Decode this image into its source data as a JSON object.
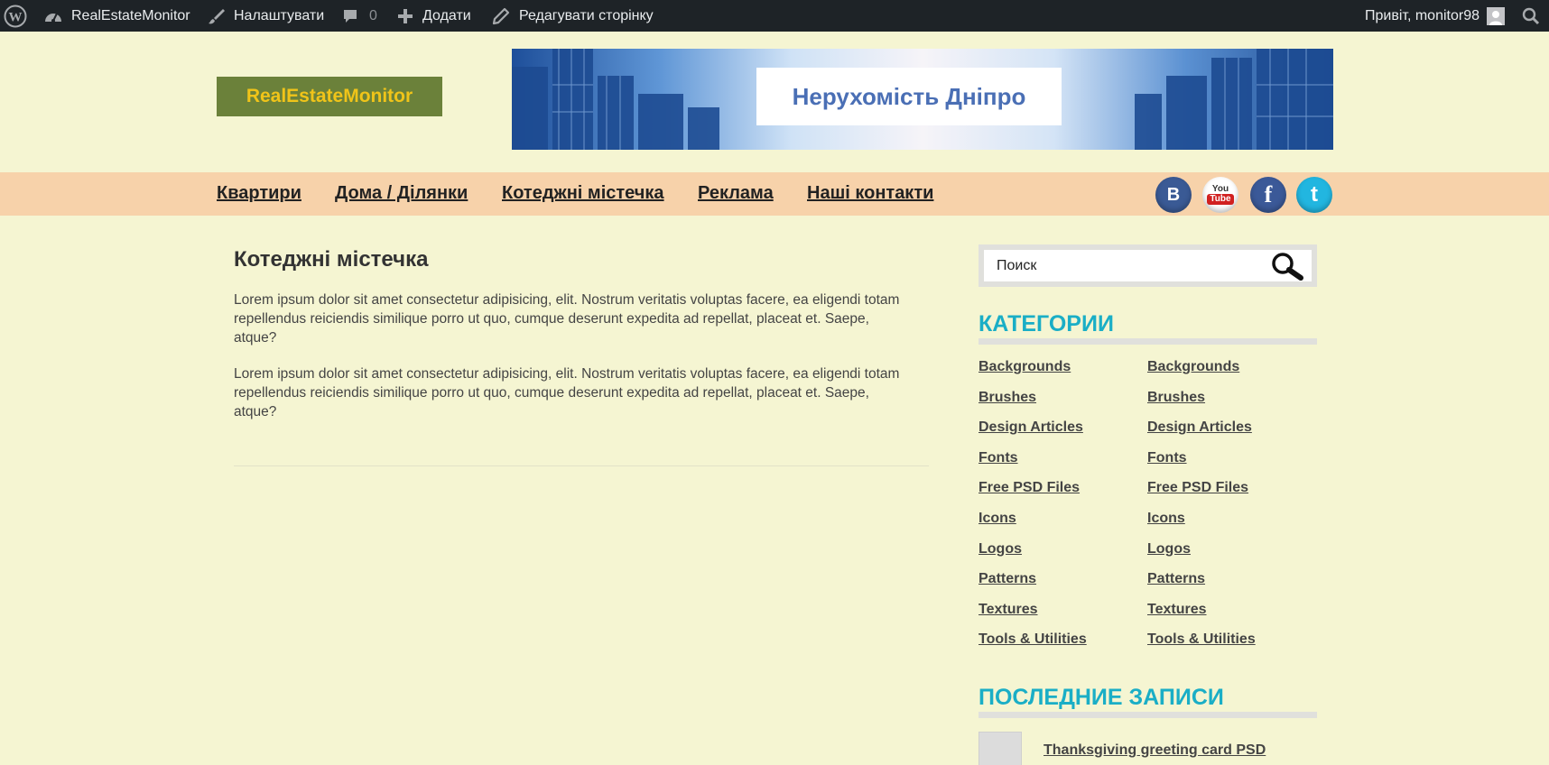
{
  "admin_bar": {
    "site_name": "RealEstateMonitor",
    "customize_label": "Налаштувати",
    "comments_count": "0",
    "add_label": "Додати",
    "edit_page_label": "Редагувати сторінку",
    "greeting": "Привіт, monitor98"
  },
  "header": {
    "logo_text": "RealEstateMonitor",
    "banner_text": "Нерухомість Дніпро"
  },
  "nav": {
    "items": [
      {
        "label": "Квартири"
      },
      {
        "label": "Дома / Ділянки"
      },
      {
        "label": "Котеджні містечка"
      },
      {
        "label": "Реклама"
      },
      {
        "label": "Наші контакти"
      }
    ],
    "social": [
      "vk-icon",
      "youtube-icon",
      "facebook-icon",
      "twitter-icon"
    ]
  },
  "main": {
    "title": "Котеджні містечка",
    "paragraphs": [
      "Lorem ipsum dolor sit amet consectetur adipisicing, elit. Nostrum veritatis voluptas facere, ea eligendi totam repellendus reiciendis similique porro ut quo, cumque deserunt expedita ad repellat, placeat et. Saepe, atque?",
      "Lorem ipsum dolor sit amet consectetur adipisicing, elit. Nostrum veritatis voluptas facere, ea eligendi totam repellendus reiciendis similique porro ut quo, cumque deserunt expedita ad repellat, placeat et. Saepe, atque?"
    ]
  },
  "sidebar": {
    "search_placeholder": "Поиск",
    "categories_title": "Категории",
    "categories": [
      "Backgrounds",
      "Brushes",
      "Design Articles",
      "Fonts",
      "Free PSD Files",
      "Icons",
      "Logos",
      "Patterns",
      "Textures",
      "Tools & Utilities"
    ],
    "recent_title": "Последние записи",
    "recent_posts": [
      {
        "title": "Thanksgiving greeting card PSD"
      }
    ]
  },
  "colors": {
    "page_bg": "#f5f5d2",
    "nav_bg": "#f7d2aa",
    "accent": "#1aaec6",
    "logo_bg": "#6b813a",
    "logo_text": "#f0c419",
    "admin_bar": "#1e2327"
  }
}
